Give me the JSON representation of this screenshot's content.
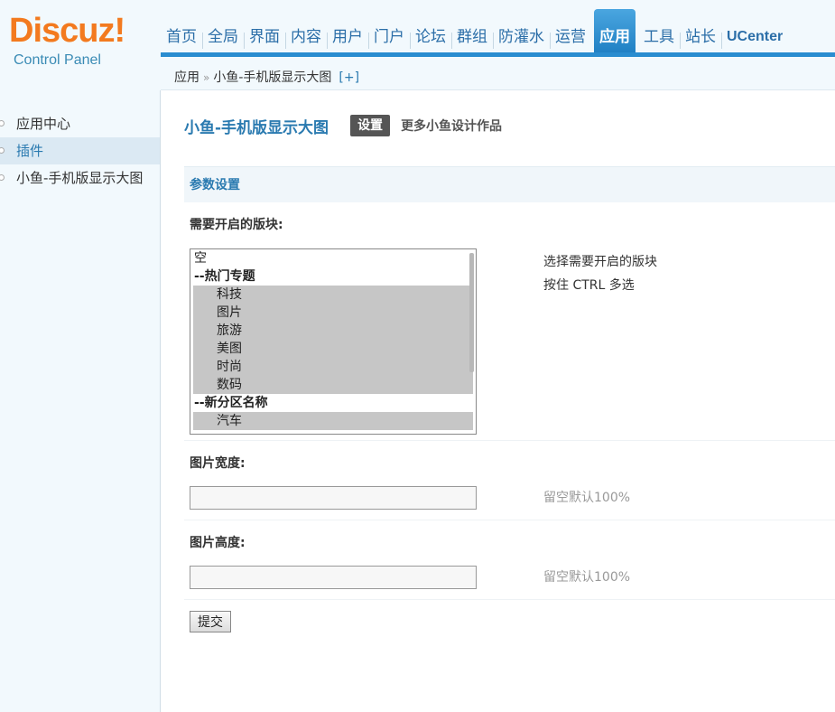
{
  "logo": {
    "word": "Discuz",
    "bang": "!",
    "subtitle": "Control Panel"
  },
  "nav": {
    "items": [
      {
        "label": "首页"
      },
      {
        "label": "全局"
      },
      {
        "label": "界面"
      },
      {
        "label": "内容"
      },
      {
        "label": "用户"
      },
      {
        "label": "门户"
      },
      {
        "label": "论坛"
      },
      {
        "label": "群组"
      },
      {
        "label": "防灌水"
      },
      {
        "label": "运营"
      },
      {
        "label": "应用"
      },
      {
        "label": "工具"
      },
      {
        "label": "站长"
      },
      {
        "label": "UCenter"
      }
    ],
    "active_index": 10
  },
  "breadcrumb": {
    "root": "应用",
    "separator": "»",
    "current": "小鱼-手机版显示大图",
    "add": "[+]"
  },
  "sidebar": {
    "items": [
      {
        "label": "应用中心"
      },
      {
        "label": "插件"
      },
      {
        "label": "小鱼-手机版显示大图"
      }
    ],
    "active_index": 1
  },
  "main": {
    "title": "小鱼-手机版显示大图",
    "settings_label": "设置",
    "more_label": "更多小鱼设计作品",
    "section_title": "参数设置",
    "blocks_field": {
      "label": "需要开启的版块:",
      "options": [
        {
          "label": "空",
          "kind": "plain"
        },
        {
          "label": "--热门专题",
          "kind": "group"
        },
        {
          "label": "科技",
          "kind": "child"
        },
        {
          "label": "图片",
          "kind": "child"
        },
        {
          "label": "旅游",
          "kind": "child"
        },
        {
          "label": "美图",
          "kind": "child"
        },
        {
          "label": "时尚",
          "kind": "child"
        },
        {
          "label": "数码",
          "kind": "child"
        },
        {
          "label": "--新分区名称",
          "kind": "group"
        },
        {
          "label": "汽车",
          "kind": "child"
        }
      ],
      "hint_line1": "选择需要开启的版块",
      "hint_line2": "按住 CTRL 多选"
    },
    "width_field": {
      "label": "图片宽度:",
      "value": "",
      "hint": "留空默认100%"
    },
    "height_field": {
      "label": "图片高度:",
      "value": "",
      "hint": "留空默认100%"
    },
    "submit_label": "提交"
  }
}
